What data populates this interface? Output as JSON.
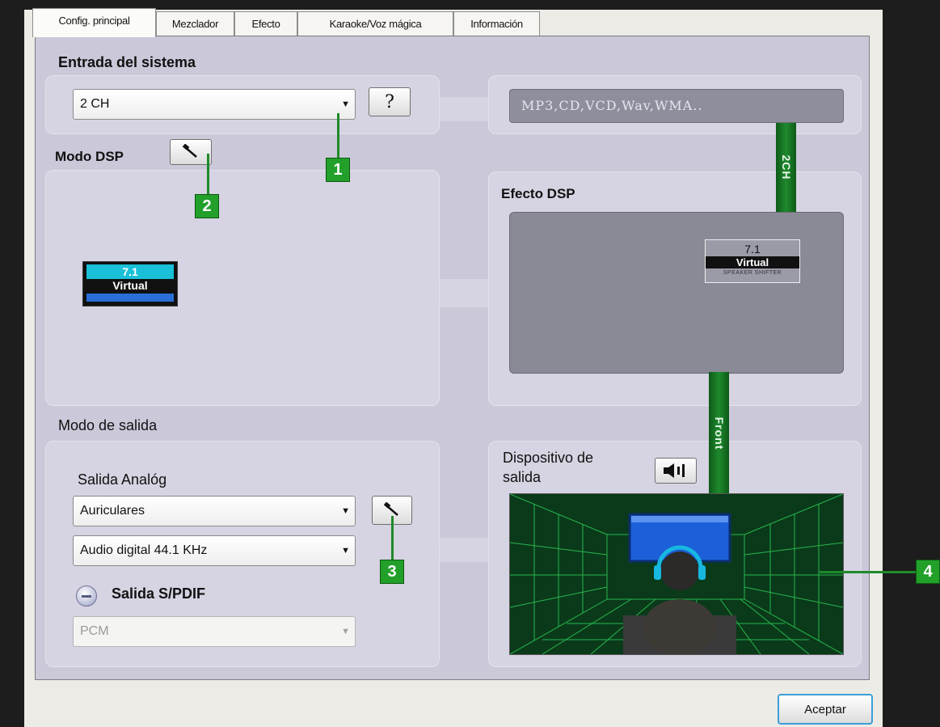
{
  "tabs": [
    {
      "label": "Config. principal",
      "active": true
    },
    {
      "label": "Mezclador",
      "active": false
    },
    {
      "label": "Efecto",
      "active": false
    },
    {
      "label": "Karaoke/Voz mágica",
      "active": false
    },
    {
      "label": "Información",
      "active": false
    }
  ],
  "input": {
    "heading": "Entrada del sistema",
    "select_value": "2 CH",
    "help_label": "?",
    "sources": "MP3,CD,VCD,Wav,WMA..",
    "channel_label": "2CH"
  },
  "dsp": {
    "heading": "Modo DSP",
    "logo_top": "7.1",
    "logo_mid": "Virtual",
    "effect_heading": "Efecto DSP",
    "effect_logo_top": "7.1",
    "effect_logo_mid": "Virtual",
    "effect_logo_bottom": "SPEAKER SHIFTER",
    "front_label": "Front"
  },
  "output": {
    "heading": "Modo de salida",
    "analog_label": "Salida Analóg",
    "analog_select": "Auriculares",
    "digital_select": "Audio digital  44.1 KHz",
    "spdif_label": "Salida S/PDIF",
    "spdif_select": "PCM",
    "device_heading_line1": "Dispositivo de",
    "device_heading_line2": "salida"
  },
  "markers": [
    "1",
    "2",
    "3",
    "4"
  ],
  "footer": {
    "accept_label": "Aceptar"
  },
  "colors": {
    "panel_bg": "#cbc8d9",
    "box_bg": "#d6d3e2",
    "marker_green": "#22a02a",
    "channel_green": "#1f8a2e",
    "screen_gray": "#8a8a96",
    "room_bg": "#0a3a1a"
  }
}
